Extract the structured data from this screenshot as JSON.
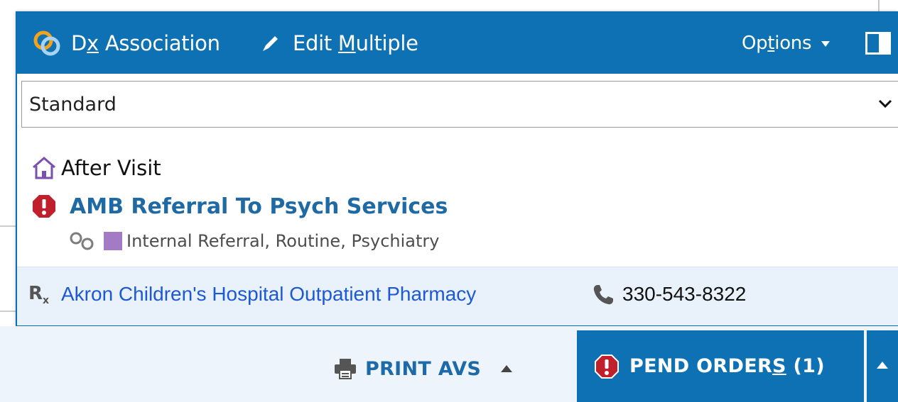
{
  "toolbar": {
    "dx_prefix": "D",
    "dx_underlined": "x",
    "dx_suffix": " Association",
    "edit_prefix": "Edit ",
    "edit_underlined": "M",
    "edit_suffix": "ultiple",
    "options_prefix": "Op",
    "options_underlined": "t",
    "options_suffix": "ions"
  },
  "select": {
    "value": "Standard"
  },
  "after_visit": {
    "label": "After Visit"
  },
  "order": {
    "title": "AMB Referral To Psych Services",
    "detail": "Internal Referral, Routine, Psychiatry"
  },
  "pharmacy": {
    "rx_symbol": "R",
    "rx_sub": "x",
    "name": "Akron Children's Hospital Outpatient Pharmacy",
    "phone": "330-543-8322"
  },
  "actions": {
    "print_label": "PRINT AVS",
    "pend_prefix": "PEND ORDER",
    "pend_underlined": "S",
    "pend_suffix": " (1)"
  },
  "colors": {
    "toolbar_bg": "#0e71b3",
    "link_blue": "#1d58d6",
    "order_blue": "#1f6aa5",
    "alert_red": "#c0202c",
    "purple": "#a27bc4"
  },
  "icons": {
    "dx": "dx-association-icon",
    "edit": "pencil-icon",
    "panel": "panel-toggle-icon",
    "home": "house-icon",
    "alert": "alert-icon",
    "linked": "linked-circles-icon",
    "phone": "phone-icon",
    "print": "printer-icon"
  }
}
